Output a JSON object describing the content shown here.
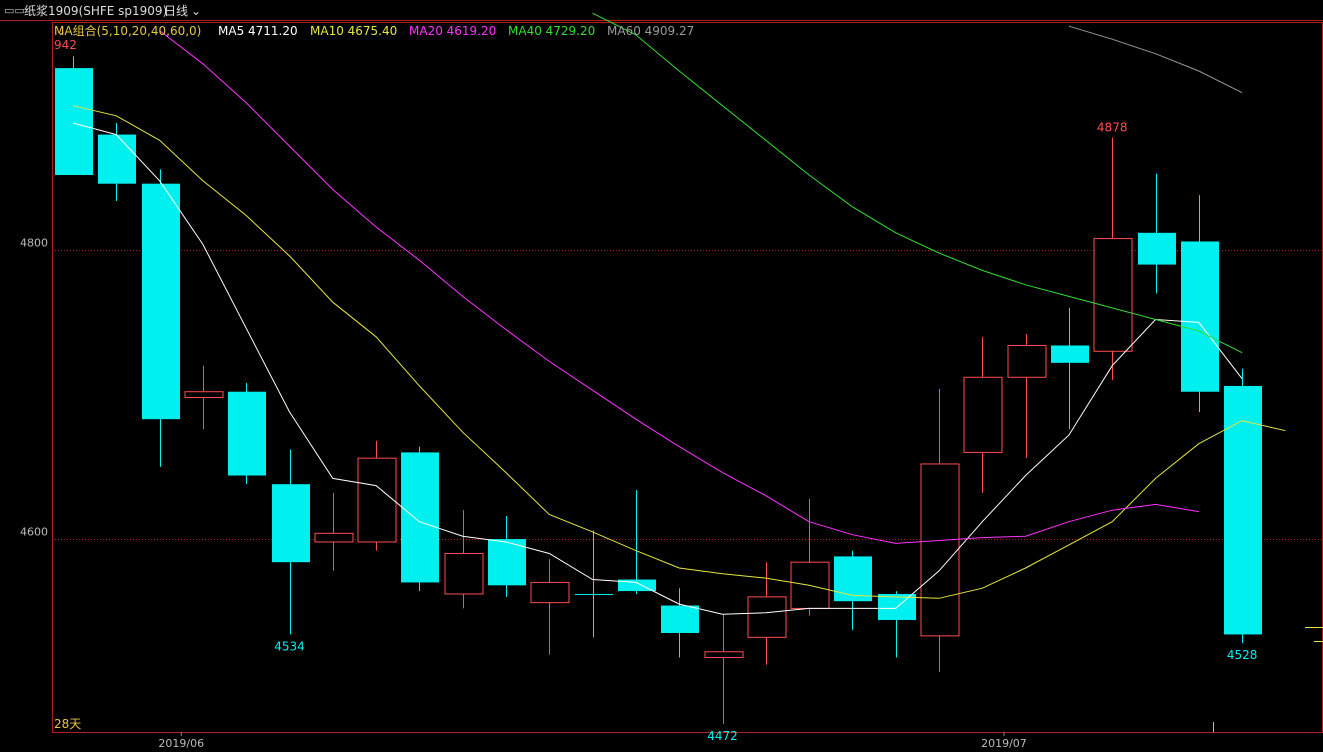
{
  "header": {
    "window_icon": "▭▭",
    "symbol": "纸浆1909(SHFE sp1909)",
    "period": "日线",
    "period_chevron": "chevron-down-icon"
  },
  "legend": {
    "group_label": "MA组合(5,10,20,40,60,0)",
    "items": [
      {
        "label": "MA5 4711.20",
        "color": "#ffffff"
      },
      {
        "label": "MA10 4675.40",
        "color": "#e6e640"
      },
      {
        "label": "MA20 4619.20",
        "color": "#ff33ff"
      },
      {
        "label": "MA40 4729.20",
        "color": "#33dd33"
      },
      {
        "label": "MA60 4909.27",
        "color": "#999999"
      }
    ]
  },
  "day_count": "28天",
  "colors": {
    "up": "#ff4d4d",
    "down": "#00f0f0",
    "grid": "#b01e1e",
    "ma5": "#ffffff",
    "ma10": "#e6e640",
    "ma20": "#ff33ff",
    "ma40": "#33dd33",
    "ma60": "#999999"
  },
  "chart_data": {
    "type": "candlestick",
    "y_ticks": [
      "4800",
      "4600"
    ],
    "ylim": [
      4455,
      4985
    ],
    "x_labels": [
      {
        "label": "2019/06",
        "index": 2.5
      },
      {
        "label": "2019/07",
        "index": 21.5
      }
    ],
    "annotations": [
      {
        "text": "942",
        "index": 0,
        "value": 4942,
        "type": "high"
      },
      {
        "text": "4534",
        "index": 5,
        "value": 4534,
        "type": "low"
      },
      {
        "text": "4472",
        "index": 15,
        "value": 4472,
        "type": "low"
      },
      {
        "text": "4878",
        "index": 24,
        "value": 4878,
        "type": "high"
      },
      {
        "text": "4528",
        "index": 27,
        "value": 4528,
        "type": "low"
      }
    ],
    "candles": [
      {
        "o": 4926,
        "h": 4934,
        "l": 4855,
        "c": 4852
      },
      {
        "o": 4880,
        "h": 4888,
        "l": 4834,
        "c": 4846
      },
      {
        "o": 4846,
        "h": 4856,
        "l": 4650,
        "c": 4683
      },
      {
        "o": 4698,
        "h": 4720,
        "l": 4676,
        "c": 4702
      },
      {
        "o": 4702,
        "h": 4708,
        "l": 4638,
        "c": 4644
      },
      {
        "o": 4638,
        "h": 4662,
        "l": 4534,
        "c": 4584
      },
      {
        "o": 4598,
        "h": 4632,
        "l": 4578,
        "c": 4604
      },
      {
        "o": 4598,
        "h": 4668,
        "l": 4592,
        "c": 4656
      },
      {
        "o": 4660,
        "h": 4664,
        "l": 4564,
        "c": 4570
      },
      {
        "o": 4562,
        "h": 4620,
        "l": 4552,
        "c": 4590
      },
      {
        "o": 4600,
        "h": 4616,
        "l": 4560,
        "c": 4568
      },
      {
        "o": 4556,
        "h": 4586,
        "l": 4520,
        "c": 4570
      },
      {
        "o": 4562,
        "h": 4606,
        "l": 4532,
        "c": 4562
      },
      {
        "o": 4572,
        "h": 4634,
        "l": 4562,
        "c": 4564
      },
      {
        "o": 4554,
        "h": 4566,
        "l": 4518,
        "c": 4535
      },
      {
        "o": 4518,
        "h": 4548,
        "l": 4472,
        "c": 4522
      },
      {
        "o": 4532,
        "h": 4584,
        "l": 4513,
        "c": 4560
      },
      {
        "o": 4552,
        "h": 4628,
        "l": 4547,
        "c": 4584
      },
      {
        "o": 4588,
        "h": 4592,
        "l": 4537,
        "c": 4557
      },
      {
        "o": 4562,
        "h": 4564,
        "l": 4518,
        "c": 4544
      },
      {
        "o": 4533,
        "h": 4704,
        "l": 4508,
        "c": 4652
      },
      {
        "o": 4660,
        "h": 4740,
        "l": 4632,
        "c": 4712
      },
      {
        "o": 4712,
        "h": 4742,
        "l": 4656,
        "c": 4734
      },
      {
        "o": 4734,
        "h": 4760,
        "l": 4676,
        "c": 4722
      },
      {
        "o": 4730,
        "h": 4878,
        "l": 4710,
        "c": 4808
      },
      {
        "o": 4812,
        "h": 4853,
        "l": 4770,
        "c": 4790
      },
      {
        "o": 4806,
        "h": 4838,
        "l": 4688,
        "c": 4702
      },
      {
        "o": 4706,
        "h": 4718,
        "l": 4528,
        "c": 4534
      }
    ],
    "ma_series": [
      {
        "key": "ma5",
        "start": 0,
        "values": [
          4888,
          4880,
          4848,
          4804,
          4746,
          4688,
          4642,
          4637,
          4612,
          4602,
          4598,
          4590,
          4572,
          4570,
          4555,
          4548,
          4549,
          4552,
          4552,
          4552,
          4578,
          4612,
          4644,
          4672,
          4720,
          4752,
          4750,
          4711
        ]
      },
      {
        "key": "ma10",
        "start": 0,
        "values": [
          4900,
          4893,
          4876,
          4848,
          4824,
          4796,
          4764,
          4740,
          4706,
          4674,
          4646,
          4617,
          4605,
          4592,
          4580,
          4576,
          4573,
          4568,
          4561,
          4560,
          4559,
          4566,
          4580,
          4596,
          4612,
          4642,
          4666,
          4682,
          4675
        ]
      },
      {
        "key": "ma20",
        "start": 2,
        "values": [
          4952,
          4929,
          4902,
          4872,
          4842,
          4816,
          4793,
          4768,
          4745,
          4723,
          4703,
          4683,
          4664,
          4646,
          4630,
          4612,
          4603,
          4597,
          4599,
          4601,
          4602,
          4612,
          4620,
          4624,
          4619
        ]
      },
      {
        "key": "ma40",
        "start": 12,
        "values": [
          4964,
          4949,
          4924,
          4900,
          4876,
          4852,
          4830,
          4812,
          4798,
          4786,
          4776,
          4768,
          4760,
          4752,
          4744,
          4729
        ]
      },
      {
        "key": "ma60",
        "start": 23,
        "values": [
          4955,
          4946,
          4936,
          4924,
          4909
        ]
      }
    ]
  }
}
